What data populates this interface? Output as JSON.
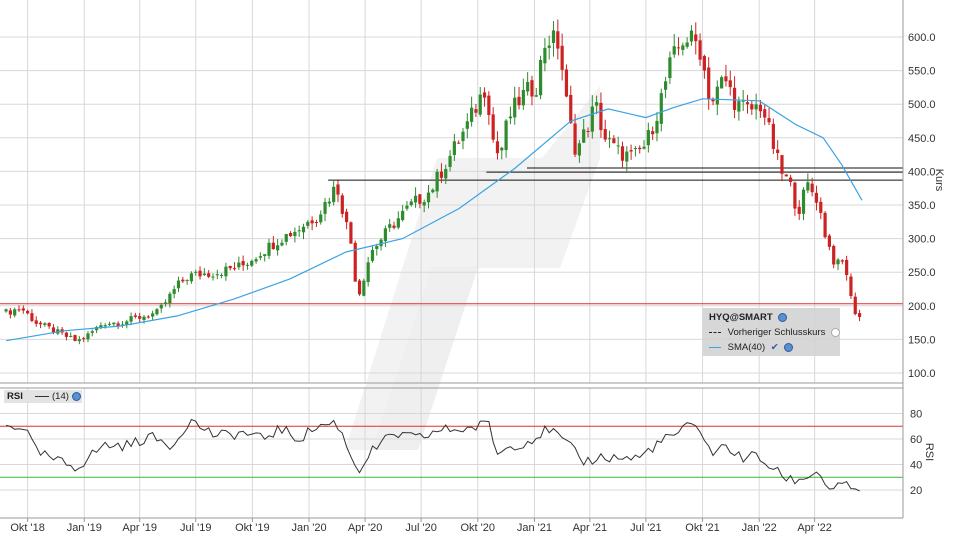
{
  "colors": {
    "up": "#2e8b2e",
    "down": "#cc2222",
    "sma": "#3aa3e3",
    "rsi": "#333333",
    "rsi_upper": "#e03030",
    "rsi_lower": "#33bb33",
    "prev_close": "#e03030",
    "support": "#111111",
    "grid": "#d8d8d8"
  },
  "chart_data": [
    {
      "type": "candlestick",
      "title": "HYQ@SMART",
      "ylabel": "Kurs",
      "ylim": [
        75,
        625
      ],
      "y_ticks": [
        "100.0",
        "150.0",
        "200.0",
        "250.0",
        "300.0",
        "350.0",
        "400.0",
        "450.0",
        "500.0",
        "550.0",
        "600.0"
      ],
      "x_ticks": [
        "Okt '18",
        "Jan '19",
        "Apr '19",
        "Jul '19",
        "Okt '19",
        "Jan '20",
        "Apr '20",
        "Jul '20",
        "Okt '20",
        "Jan '21",
        "Apr '21",
        "Jul '21",
        "Okt '21",
        "Jan '22",
        "Apr '22"
      ],
      "x_range": [
        "2018-08-27",
        "2022-06-17"
      ],
      "grid": true,
      "legend": {
        "title": "HYQ@SMART",
        "items": [
          {
            "label": "Vorheriger Schlusskurs",
            "style": "dashed"
          },
          {
            "label": "SMA(40)",
            "style": "line"
          }
        ]
      },
      "horizontal_lines": [
        {
          "name": "Vorheriger Schlusskurs",
          "y": 203
        },
        {
          "y": 405,
          "from": "2020-12-20"
        },
        {
          "y": 399,
          "from": "2020-10-15"
        },
        {
          "y": 387,
          "from": "2020-02-01"
        }
      ],
      "closes": [
        {
          "x": "2018-08-27",
          "y": 190
        },
        {
          "x": "2018-09-20",
          "y": 197
        },
        {
          "x": "2018-10-15",
          "y": 175
        },
        {
          "x": "2018-11-15",
          "y": 162
        },
        {
          "x": "2018-12-20",
          "y": 147
        },
        {
          "x": "2019-01-05",
          "y": 155
        },
        {
          "x": "2019-02-01",
          "y": 175
        },
        {
          "x": "2019-03-01",
          "y": 175
        },
        {
          "x": "2019-04-01",
          "y": 183
        },
        {
          "x": "2019-05-01",
          "y": 190
        },
        {
          "x": "2019-06-01",
          "y": 230
        },
        {
          "x": "2019-06-20",
          "y": 245
        },
        {
          "x": "2019-08-05",
          "y": 250
        },
        {
          "x": "2019-09-15",
          "y": 260
        },
        {
          "x": "2019-10-15",
          "y": 280
        },
        {
          "x": "2019-11-15",
          "y": 300
        },
        {
          "x": "2019-12-15",
          "y": 315
        },
        {
          "x": "2020-01-15",
          "y": 335
        },
        {
          "x": "2020-02-15",
          "y": 380
        },
        {
          "x": "2020-03-10",
          "y": 290
        },
        {
          "x": "2020-03-20",
          "y": 210
        },
        {
          "x": "2020-04-10",
          "y": 280
        },
        {
          "x": "2020-05-15",
          "y": 320
        },
        {
          "x": "2020-06-15",
          "y": 350
        },
        {
          "x": "2020-07-15",
          "y": 370
        },
        {
          "x": "2020-08-15",
          "y": 420
        },
        {
          "x": "2020-09-15",
          "y": 470
        },
        {
          "x": "2020-10-15",
          "y": 530
        },
        {
          "x": "2020-10-25",
          "y": 450
        },
        {
          "x": "2020-11-05",
          "y": 420
        },
        {
          "x": "2020-11-20",
          "y": 480
        },
        {
          "x": "2020-12-10",
          "y": 510
        },
        {
          "x": "2021-01-05",
          "y": 530
        },
        {
          "x": "2021-01-20",
          "y": 600
        },
        {
          "x": "2021-02-10",
          "y": 590
        },
        {
          "x": "2021-02-25",
          "y": 480
        },
        {
          "x": "2021-03-10",
          "y": 430
        },
        {
          "x": "2021-03-25",
          "y": 460
        },
        {
          "x": "2021-04-10",
          "y": 500
        },
        {
          "x": "2021-04-25",
          "y": 450
        },
        {
          "x": "2021-05-15",
          "y": 430
        },
        {
          "x": "2021-06-10",
          "y": 420
        },
        {
          "x": "2021-07-01",
          "y": 440
        },
        {
          "x": "2021-07-20",
          "y": 490
        },
        {
          "x": "2021-08-10",
          "y": 560
        },
        {
          "x": "2021-09-01",
          "y": 600
        },
        {
          "x": "2021-09-25",
          "y": 590
        },
        {
          "x": "2021-10-15",
          "y": 500
        },
        {
          "x": "2021-11-05",
          "y": 540
        },
        {
          "x": "2021-11-25",
          "y": 500
        },
        {
          "x": "2021-12-15",
          "y": 490
        },
        {
          "x": "2022-01-05",
          "y": 500
        },
        {
          "x": "2022-01-20",
          "y": 450
        },
        {
          "x": "2022-02-05",
          "y": 400
        },
        {
          "x": "2022-02-20",
          "y": 380
        },
        {
          "x": "2022-03-05",
          "y": 340
        },
        {
          "x": "2022-03-20",
          "y": 380
        },
        {
          "x": "2022-04-05",
          "y": 360
        },
        {
          "x": "2022-04-20",
          "y": 300
        },
        {
          "x": "2022-05-05",
          "y": 260
        },
        {
          "x": "2022-05-20",
          "y": 265
        },
        {
          "x": "2022-06-01",
          "y": 200
        },
        {
          "x": "2022-06-10",
          "y": 185
        },
        {
          "x": "2022-06-17",
          "y": 182
        }
      ],
      "series": [
        {
          "name": "SMA(40)",
          "points": [
            {
              "x": "2018-08-27",
              "y": 148
            },
            {
              "x": "2018-12-01",
              "y": 163
            },
            {
              "x": "2019-03-01",
              "y": 170
            },
            {
              "x": "2019-06-01",
              "y": 185
            },
            {
              "x": "2019-09-01",
              "y": 210
            },
            {
              "x": "2019-12-01",
              "y": 240
            },
            {
              "x": "2020-03-01",
              "y": 280
            },
            {
              "x": "2020-06-01",
              "y": 300
            },
            {
              "x": "2020-09-01",
              "y": 345
            },
            {
              "x": "2020-12-01",
              "y": 405
            },
            {
              "x": "2021-03-01",
              "y": 475
            },
            {
              "x": "2021-05-01",
              "y": 493
            },
            {
              "x": "2021-07-01",
              "y": 480
            },
            {
              "x": "2021-08-15",
              "y": 495
            },
            {
              "x": "2021-10-01",
              "y": 508
            },
            {
              "x": "2022-01-01",
              "y": 505
            },
            {
              "x": "2022-03-01",
              "y": 470
            },
            {
              "x": "2022-04-15",
              "y": 450
            },
            {
              "x": "2022-05-15",
              "y": 410
            },
            {
              "x": "2022-06-17",
              "y": 357
            }
          ]
        }
      ]
    },
    {
      "type": "line",
      "title": "RSI",
      "ylabel": "RSI",
      "ylim": [
        10,
        90
      ],
      "y_ticks": [
        "20",
        "40",
        "60",
        "80"
      ],
      "legend": {
        "items": [
          {
            "label": "(14)",
            "style": "line"
          }
        ]
      },
      "levels": [
        70,
        30
      ],
      "series": [
        {
          "name": "(14)",
          "points": [
            {
              "x": "2018-08-27",
              "y": 70
            },
            {
              "x": "2018-09-25",
              "y": 70
            },
            {
              "x": "2018-10-15",
              "y": 50
            },
            {
              "x": "2018-11-15",
              "y": 43
            },
            {
              "x": "2018-12-20",
              "y": 38
            },
            {
              "x": "2019-02-01",
              "y": 55
            },
            {
              "x": "2019-03-15",
              "y": 55
            },
            {
              "x": "2019-04-15",
              "y": 62
            },
            {
              "x": "2019-05-25",
              "y": 55
            },
            {
              "x": "2019-06-20",
              "y": 75
            },
            {
              "x": "2019-08-05",
              "y": 62
            },
            {
              "x": "2019-09-15",
              "y": 65
            },
            {
              "x": "2019-10-15",
              "y": 60
            },
            {
              "x": "2019-11-15",
              "y": 68
            },
            {
              "x": "2019-12-15",
              "y": 60
            },
            {
              "x": "2020-01-15",
              "y": 70
            },
            {
              "x": "2020-02-15",
              "y": 73
            },
            {
              "x": "2020-03-20",
              "y": 35
            },
            {
              "x": "2020-04-15",
              "y": 52
            },
            {
              "x": "2020-05-20",
              "y": 64
            },
            {
              "x": "2020-06-25",
              "y": 60
            },
            {
              "x": "2020-08-01",
              "y": 67
            },
            {
              "x": "2020-09-15",
              "y": 68
            },
            {
              "x": "2020-10-20",
              "y": 72
            },
            {
              "x": "2020-11-01",
              "y": 48
            },
            {
              "x": "2020-11-25",
              "y": 55
            },
            {
              "x": "2020-12-20",
              "y": 58
            },
            {
              "x": "2021-01-25",
              "y": 68
            },
            {
              "x": "2021-02-25",
              "y": 55
            },
            {
              "x": "2021-03-20",
              "y": 42
            },
            {
              "x": "2021-04-20",
              "y": 46
            },
            {
              "x": "2021-05-20",
              "y": 45
            },
            {
              "x": "2021-06-20",
              "y": 45
            },
            {
              "x": "2021-07-15",
              "y": 55
            },
            {
              "x": "2021-08-15",
              "y": 63
            },
            {
              "x": "2021-09-10",
              "y": 70
            },
            {
              "x": "2021-09-30",
              "y": 67
            },
            {
              "x": "2021-10-15",
              "y": 48
            },
            {
              "x": "2021-11-10",
              "y": 55
            },
            {
              "x": "2021-12-01",
              "y": 45
            },
            {
              "x": "2021-12-25",
              "y": 47
            },
            {
              "x": "2022-01-15",
              "y": 40
            },
            {
              "x": "2022-02-01",
              "y": 33
            },
            {
              "x": "2022-02-20",
              "y": 28
            },
            {
              "x": "2022-03-10",
              "y": 28
            },
            {
              "x": "2022-03-25",
              "y": 32
            },
            {
              "x": "2022-04-05",
              "y": 36
            },
            {
              "x": "2022-04-20",
              "y": 22
            },
            {
              "x": "2022-05-20",
              "y": 23
            },
            {
              "x": "2022-06-01",
              "y": 20
            },
            {
              "x": "2022-06-17",
              "y": 22
            }
          ]
        }
      ]
    }
  ]
}
